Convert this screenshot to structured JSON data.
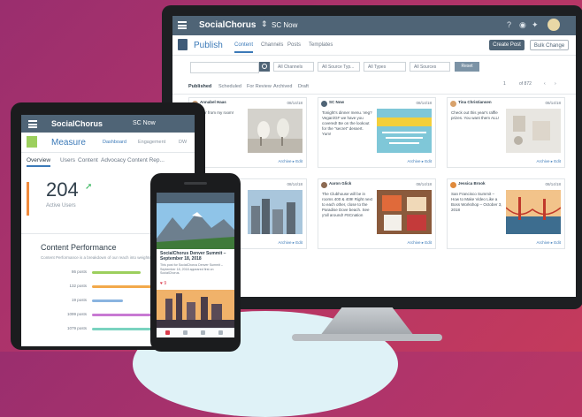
{
  "desktop": {
    "brand": "SocialChorus",
    "program": "SC Now",
    "section_title": "Publish",
    "section_tabs": [
      "Content",
      "Channels",
      "Posts",
      "Templates"
    ],
    "buttons": {
      "create": "Create Post",
      "bulk": "Bulk Change"
    },
    "filters": [
      "All Channels",
      "All Source Typ...",
      "All Types",
      "All Sources"
    ],
    "reset_label": "Reset",
    "view_tabs": [
      "Published",
      "Scheduled",
      "For Review",
      "Archived",
      "Draft"
    ],
    "pager": {
      "page": "1",
      "of": "of 872"
    },
    "cards": [
      {
        "name": "Annabel Haas",
        "date": "08/14/18",
        "text": "A visitor from my room!",
        "footer": "Archive ▸ Edit",
        "img": "pelicans"
      },
      {
        "name": "SC Now",
        "date": "08/14/18",
        "text": "Tonight's dinner menu. Veg?Vegan/GF we have you covered! Be on the lookout for the \"secret\" dessert. Yum!",
        "footer": "Archive ▸ Edit",
        "img": "menu"
      },
      {
        "name": "Tina Christiansen",
        "date": "08/14/18",
        "text": "Check out this year's raffle prizes. You want them ALL!",
        "footer": "Archive ▸ Edit",
        "img": "prizes"
      },
      {
        "name": "",
        "date": "08/14/18",
        "text": "",
        "footer": "Archive ▸ Edit",
        "img": "city"
      },
      {
        "name": "Aaron Glick",
        "date": "08/14/18",
        "text": "The Clubhouse will be in rooms 400 & 409! Right next to each other, close to the Paradise Dove beach. See y'all around! #SCnation",
        "footer": "Archive ▸ Edit",
        "img": "food"
      },
      {
        "name": "Jessica Brook",
        "date": "08/14/18",
        "text": "San Francisco Summit – How to Make Video Like a Boss Workshop – October 3, 2018",
        "footer": "Archive ▸ Edit",
        "img": "bridge"
      }
    ],
    "colors": {
      "header": "#4f6476",
      "accent": "#3c7ab8"
    }
  },
  "tablet": {
    "brand": "SocialChorus",
    "program": "SC Now",
    "section_title": "Measure",
    "section_tabs": [
      "Dashboard",
      "Engagement",
      "DW"
    ],
    "sub_tabs": [
      "Overview",
      "Users",
      "Content",
      "Advocacy",
      "Content Rep..."
    ],
    "stat_value": "204",
    "stat_label": "Active Users",
    "perf_title": "Content Performance",
    "perf_subtitle": "Content Performance is a breakdown of our reach into weighted groupings",
    "perf_rows": [
      {
        "label": "86 posts",
        "color": "#9ccf5d",
        "pct": 0.55
      },
      {
        "label": "132 posts",
        "color": "#f2a94a",
        "pct": 0.7
      },
      {
        "label": "19 posts",
        "color": "#8ab4e0",
        "pct": 0.35
      },
      {
        "label": "1099 posts",
        "color": "#c87ad3",
        "pct": 0.85
      },
      {
        "label": "1079 posts",
        "color": "#7ad3c0",
        "pct": 0.8
      }
    ]
  },
  "phone": {
    "post_title": "SocialChorus Denver Summit – September 18, 2018",
    "post_text": "This post for SocialChorus Denver Summit – September 18, 2018 appeared first on SocialChorus.",
    "likes": "♥ 9"
  }
}
